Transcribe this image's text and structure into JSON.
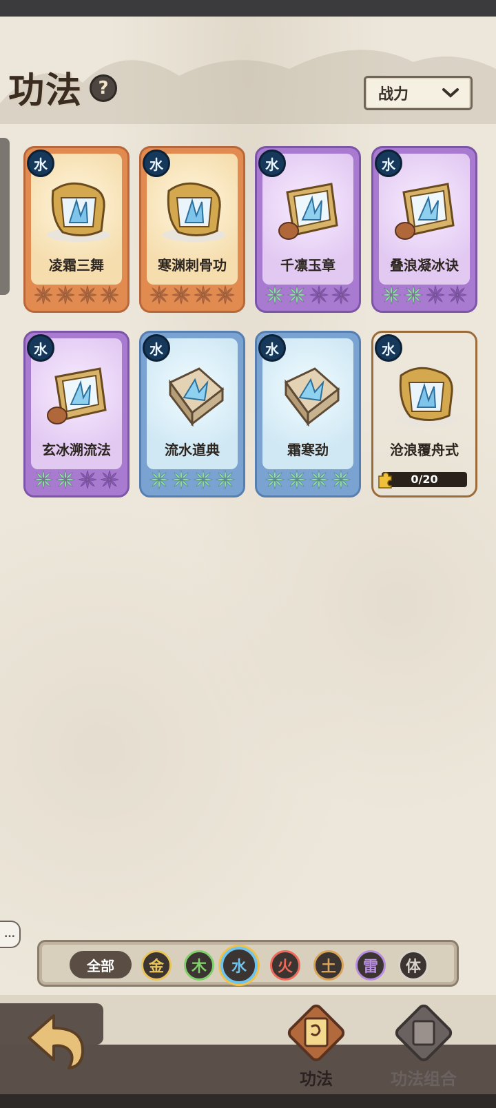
{
  "header": {
    "title": "功法",
    "help_symbol": "?",
    "sort": {
      "selected": "战力"
    }
  },
  "cards": [
    {
      "name": "凌霜三舞",
      "element": "水",
      "rarity": "orange",
      "stars_lit": 0,
      "stars_total": 4
    },
    {
      "name": "寒渊刺骨功",
      "element": "水",
      "rarity": "orange",
      "stars_lit": 0,
      "stars_total": 4
    },
    {
      "name": "千凛玉章",
      "element": "水",
      "rarity": "purple",
      "stars_lit": 2,
      "stars_total": 4
    },
    {
      "name": "叠浪凝冰诀",
      "element": "水",
      "rarity": "purple",
      "stars_lit": 2,
      "stars_total": 4
    },
    {
      "name": "玄冰溯流法",
      "element": "水",
      "rarity": "purple",
      "stars_lit": 2,
      "stars_total": 4
    },
    {
      "name": "流水道典",
      "element": "水",
      "rarity": "blue",
      "stars_lit": 4,
      "stars_total": 4
    },
    {
      "name": "霜寒劲",
      "element": "水",
      "rarity": "blue",
      "stars_lit": 4,
      "stars_total": 4
    },
    {
      "name": "沧浪覆舟式",
      "element": "水",
      "rarity": "locked",
      "fragments": "0/20"
    }
  ],
  "chat": {
    "symbol": "..."
  },
  "filters": {
    "all_label": "全部",
    "elements": [
      {
        "label": "金",
        "color": "#e8c45a",
        "active": false
      },
      {
        "label": "木",
        "color": "#7fd06a",
        "active": false
      },
      {
        "label": "水",
        "color": "#6fc4ee",
        "active": true
      },
      {
        "label": "火",
        "color": "#ee6a5a",
        "active": false
      },
      {
        "label": "土",
        "color": "#d9a35a",
        "active": false
      },
      {
        "label": "雷",
        "color": "#b98ee0",
        "active": false
      },
      {
        "label": "体",
        "color": "#d8d4cc",
        "active": false
      }
    ]
  },
  "bottom_nav": {
    "tabs": [
      {
        "label": "功法",
        "active": true
      },
      {
        "label": "功法组合",
        "active": false
      }
    ]
  },
  "colors": {
    "star_lit": "#8ee0a8",
    "star_dim_orange": "#b46a44",
    "star_dim_purple": "#8a5ab8",
    "element_badge": "#16385a",
    "active_filter_ring": "#f0c24a"
  }
}
